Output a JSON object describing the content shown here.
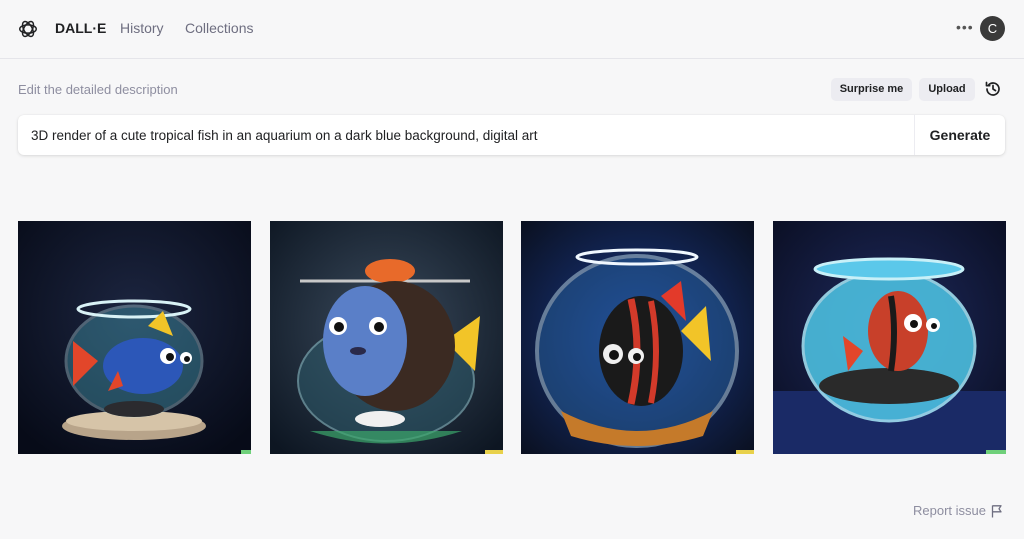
{
  "nav": {
    "brand": "DALL·E",
    "history": "History",
    "collections": "Collections",
    "more_icon": "ellipsis-icon",
    "avatar_initial": "C"
  },
  "editor": {
    "hint": "Edit the detailed description",
    "surprise_label": "Surprise me",
    "upload_label": "Upload",
    "history_icon": "history-icon",
    "prompt_value": "3D render of a cute tropical fish in an aquarium on a dark blue background, digital art",
    "generate_label": "Generate"
  },
  "results": {
    "images": [
      {
        "alt": "blue and orange fish in small bowl"
      },
      {
        "alt": "round blue and brown fish in glass bowl"
      },
      {
        "alt": "red and black striped fish in fishbowl"
      },
      {
        "alt": "red striped fish in blue bowl"
      }
    ]
  },
  "footer": {
    "report_label": "Report issue",
    "flag_icon": "flag-icon"
  },
  "colors": {
    "background": "#f7f7f8",
    "text": "#202123",
    "muted": "#8e8ea0"
  }
}
